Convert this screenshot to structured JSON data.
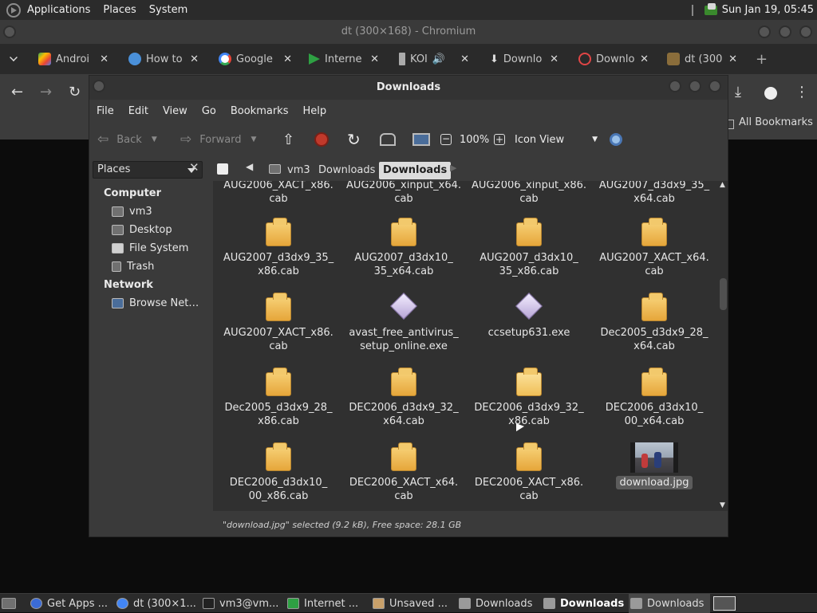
{
  "top_panel": {
    "menus": [
      "Applications",
      "Places",
      "System"
    ],
    "clock": "Sun Jan 19, 05:45"
  },
  "chromium": {
    "title": "dt (300×168) - Chromium",
    "tabs": [
      {
        "label": "Androi",
        "icon": "play-store-icon"
      },
      {
        "label": "How to",
        "icon": "site-icon"
      },
      {
        "label": "Google",
        "icon": "google-icon"
      },
      {
        "label": "Interne",
        "icon": "flag-icon"
      },
      {
        "label": "KOI",
        "icon": "audio-tab-icon"
      },
      {
        "label": "Downlo",
        "icon": "download-icon"
      },
      {
        "label": "Downlo",
        "icon": "power-icon"
      },
      {
        "label": "dt (300",
        "icon": "image-icon"
      }
    ],
    "all_bookmarks": "All Bookmarks"
  },
  "file_manager": {
    "title": "Downloads",
    "menu": [
      "File",
      "Edit",
      "View",
      "Go",
      "Bookmarks",
      "Help"
    ],
    "toolbar": {
      "back": "Back",
      "forward": "Forward",
      "zoom": "100%",
      "view_mode": "Icon View"
    },
    "places_combo": "Places",
    "breadcrumbs": [
      "vm3",
      "Downloads",
      "Downloads"
    ],
    "sidebar": {
      "computer_header": "Computer",
      "computer_items": [
        "vm3",
        "Desktop",
        "File System",
        "Trash"
      ],
      "network_header": "Network",
      "network_items": [
        "Browse Net…"
      ]
    },
    "files": [
      {
        "line1": "AUG2006_XACT_x86.",
        "line2": "cab",
        "type": "partial"
      },
      {
        "line1": "AUG2006_xinput_x64.",
        "line2": "cab",
        "type": "partial"
      },
      {
        "line1": "AUG2006_xinput_x86.",
        "line2": "cab",
        "type": "partial"
      },
      {
        "line1": "AUG2007_d3dx9_35_",
        "line2": "x64.cab",
        "type": "partial"
      },
      {
        "line1": "AUG2007_d3dx9_35_",
        "line2": "x86.cab",
        "type": "folder"
      },
      {
        "line1": "AUG2007_d3dx10_",
        "line2": "35_x64.cab",
        "type": "folder"
      },
      {
        "line1": "AUG2007_d3dx10_",
        "line2": "35_x86.cab",
        "type": "folder"
      },
      {
        "line1": "AUG2007_XACT_x64.",
        "line2": "cab",
        "type": "folder"
      },
      {
        "line1": "AUG2007_XACT_x86.",
        "line2": "cab",
        "type": "folder"
      },
      {
        "line1": "avast_free_antivirus_",
        "line2": "setup_online.exe",
        "type": "exe"
      },
      {
        "line1": "ccsetup631.exe",
        "line2": "",
        "type": "exe"
      },
      {
        "line1": "Dec2005_d3dx9_28_",
        "line2": "x64.cab",
        "type": "folder"
      },
      {
        "line1": "Dec2005_d3dx9_28_",
        "line2": "x86.cab",
        "type": "folder"
      },
      {
        "line1": "DEC2006_d3dx9_32_",
        "line2": "x64.cab",
        "type": "folder"
      },
      {
        "line1": "DEC2006_d3dx9_32_",
        "line2": "x86.cab",
        "type": "folder"
      },
      {
        "line1": "DEC2006_d3dx10_",
        "line2": "00_x64.cab",
        "type": "folder"
      },
      {
        "line1": "DEC2006_d3dx10_",
        "line2": "00_x86.cab",
        "type": "folder"
      },
      {
        "line1": "DEC2006_XACT_x64.",
        "line2": "cab",
        "type": "folder"
      },
      {
        "line1": "DEC2006_XACT_x86.",
        "line2": "cab",
        "type": "folder"
      },
      {
        "line1": "download.jpg",
        "line2": "",
        "type": "image"
      }
    ],
    "status": "\"download.jpg\" selected (9.2 kB), Free space: 28.1 GB"
  },
  "taskbar": {
    "items": [
      {
        "label": "Get Apps ..."
      },
      {
        "label": "dt (300×1..."
      },
      {
        "label": "vm3@vm..."
      },
      {
        "label": "Internet ..."
      },
      {
        "label": "Unsaved ..."
      },
      {
        "label": "Downloads"
      },
      {
        "label": "Downloads"
      },
      {
        "label": "Downloads"
      }
    ]
  }
}
